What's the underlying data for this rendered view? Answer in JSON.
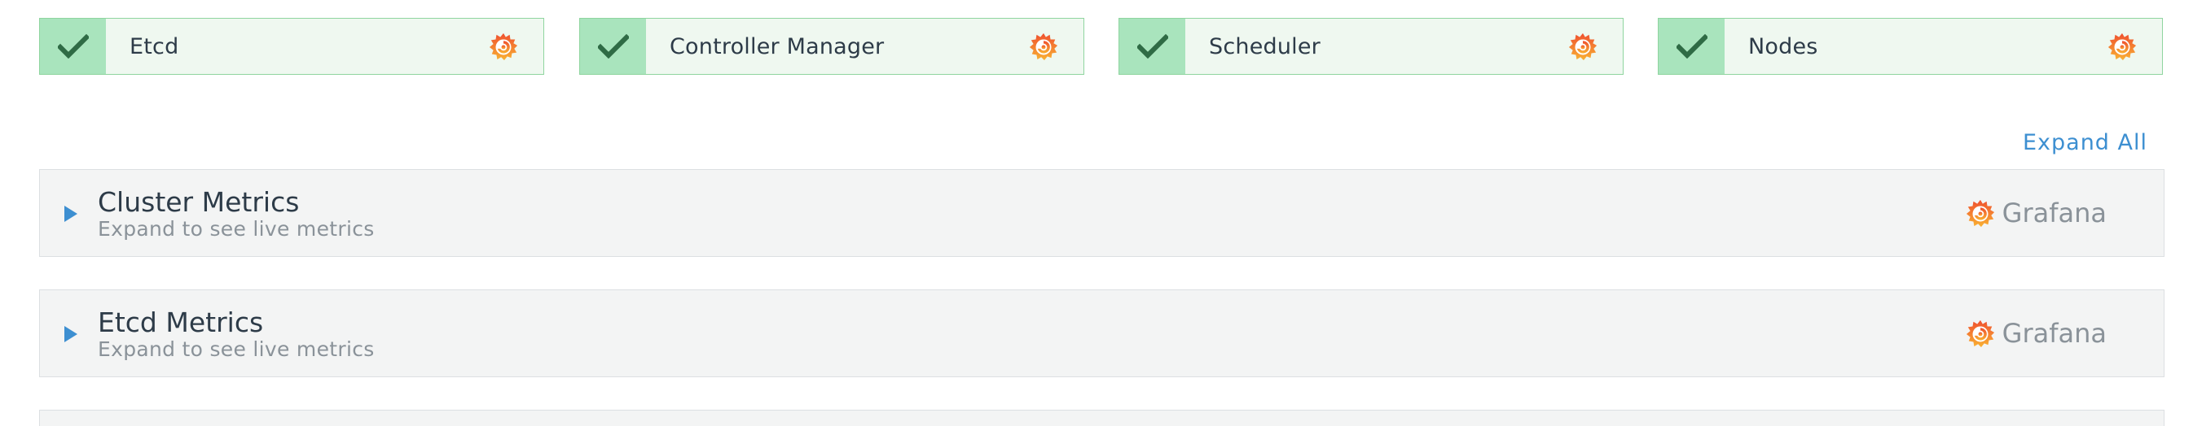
{
  "status_cards": [
    {
      "label": "Etcd",
      "status_icon": "check-icon",
      "link_icon": "grafana-icon"
    },
    {
      "label": "Controller Manager",
      "status_icon": "check-icon",
      "link_icon": "grafana-icon"
    },
    {
      "label": "Scheduler",
      "status_icon": "check-icon",
      "link_icon": "grafana-icon"
    },
    {
      "label": "Nodes",
      "status_icon": "check-icon",
      "link_icon": "grafana-icon"
    }
  ],
  "expand_all_label": "Expand All",
  "metric_panels": [
    {
      "title": "Cluster Metrics",
      "subtitle": "Expand to see live metrics",
      "link_label": "Grafana"
    },
    {
      "title": "Etcd Metrics",
      "subtitle": "Expand to see live metrics",
      "link_label": "Grafana"
    }
  ],
  "colors": {
    "card_background": "#eff8f0",
    "card_border": "#8fd59f",
    "check_background": "#a9e4bd",
    "check_mark": "#2f6b45",
    "link_blue": "#3d8fd1",
    "panel_background": "#f3f4f4",
    "grafana_orange": "#f26e2c",
    "grafana_yellow": "#f9b233"
  }
}
